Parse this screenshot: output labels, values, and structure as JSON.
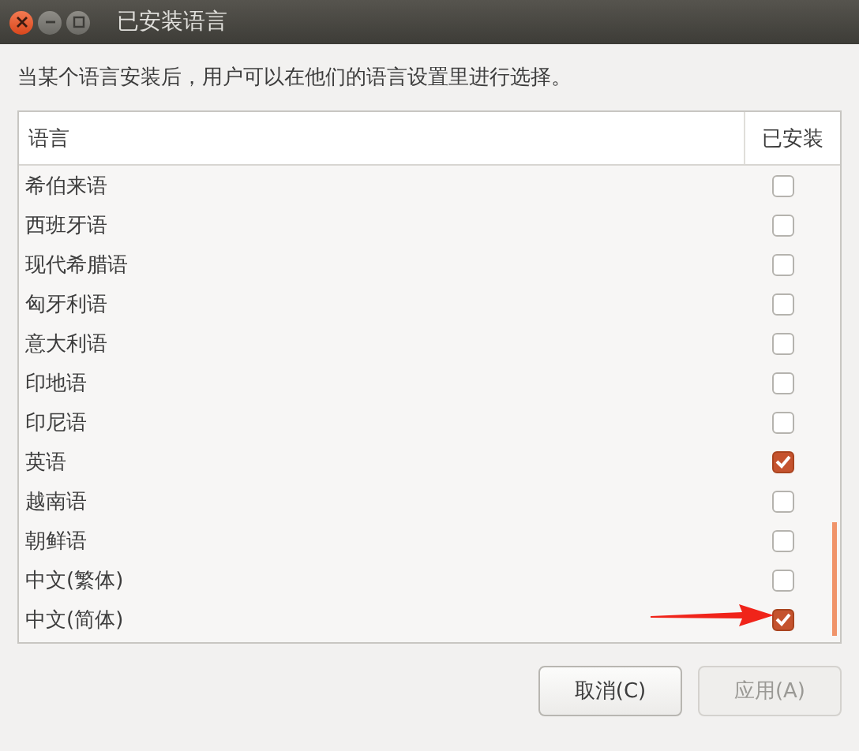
{
  "window": {
    "title": "已安装语言"
  },
  "description": "当某个语言安装后，用户可以在他们的语言设置里进行选择。",
  "table": {
    "columns": [
      "语言",
      "已安装"
    ],
    "rows": [
      {
        "name": "希伯来语",
        "checked": false
      },
      {
        "name": "西班牙语",
        "checked": false
      },
      {
        "name": "现代希腊语",
        "checked": false
      },
      {
        "name": "匈牙利语",
        "checked": false
      },
      {
        "name": "意大利语",
        "checked": false
      },
      {
        "name": "印地语",
        "checked": false
      },
      {
        "name": "印尼语",
        "checked": false
      },
      {
        "name": "英语",
        "checked": true
      },
      {
        "name": "越南语",
        "checked": false
      },
      {
        "name": "朝鲜语",
        "checked": false
      },
      {
        "name": "中文(繁体)",
        "checked": false
      },
      {
        "name": "中文(简体)",
        "checked": true
      }
    ]
  },
  "buttons": [
    {
      "label": "取消(C)",
      "disabled": false
    },
    {
      "label": "应用(A)",
      "disabled": true
    }
  ]
}
